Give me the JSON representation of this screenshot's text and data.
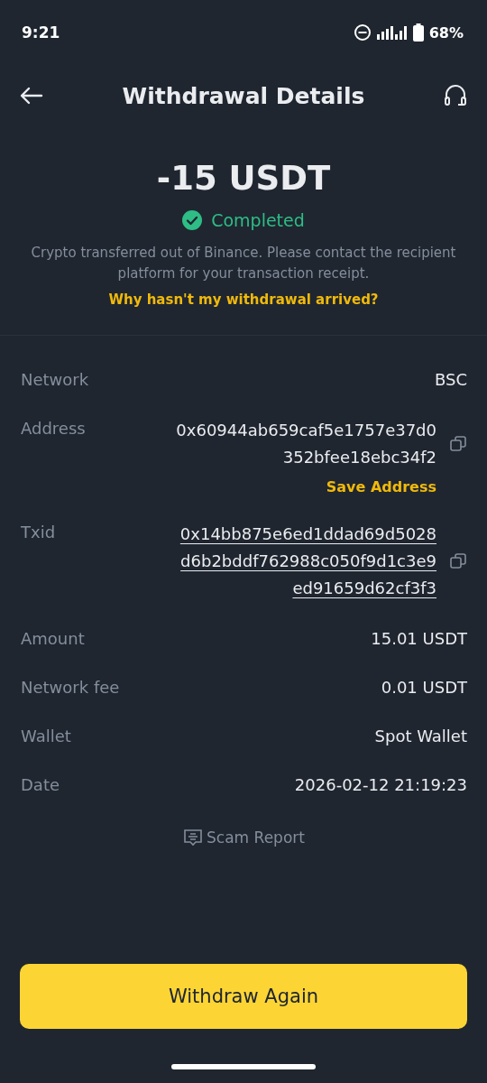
{
  "status_bar": {
    "time": "9:21",
    "battery": "68%"
  },
  "header": {
    "title": "Withdrawal Details"
  },
  "summary": {
    "amount": "-15 USDT",
    "status": "Completed",
    "note": "Crypto transferred out of Binance. Please contact the recipient platform for your transaction receipt.",
    "help_link": "Why hasn't my withdrawal arrived?"
  },
  "details": [
    {
      "kind": "plain",
      "label": "Network",
      "value": "BSC"
    },
    {
      "kind": "address",
      "label": "Address",
      "value": "0x60944ab659caf5e1757e37d0352bfee18ebc34f2",
      "action": "Save Address"
    },
    {
      "kind": "txid",
      "label": "Txid",
      "value": "0x14bb875e6ed1ddad69d5028d6b2bddf762988c050f9d1c3e9ed91659d62cf3f3"
    },
    {
      "kind": "plain",
      "label": "Amount",
      "value": "15.01 USDT"
    },
    {
      "kind": "plain",
      "label": "Network fee",
      "value": "0.01 USDT"
    },
    {
      "kind": "plain",
      "label": "Wallet",
      "value": "Spot Wallet"
    },
    {
      "kind": "plain",
      "label": "Date",
      "value": "2026-02-12 21:19:23"
    }
  ],
  "scam_report": "Scam Report",
  "primary_button": "Withdraw Again"
}
